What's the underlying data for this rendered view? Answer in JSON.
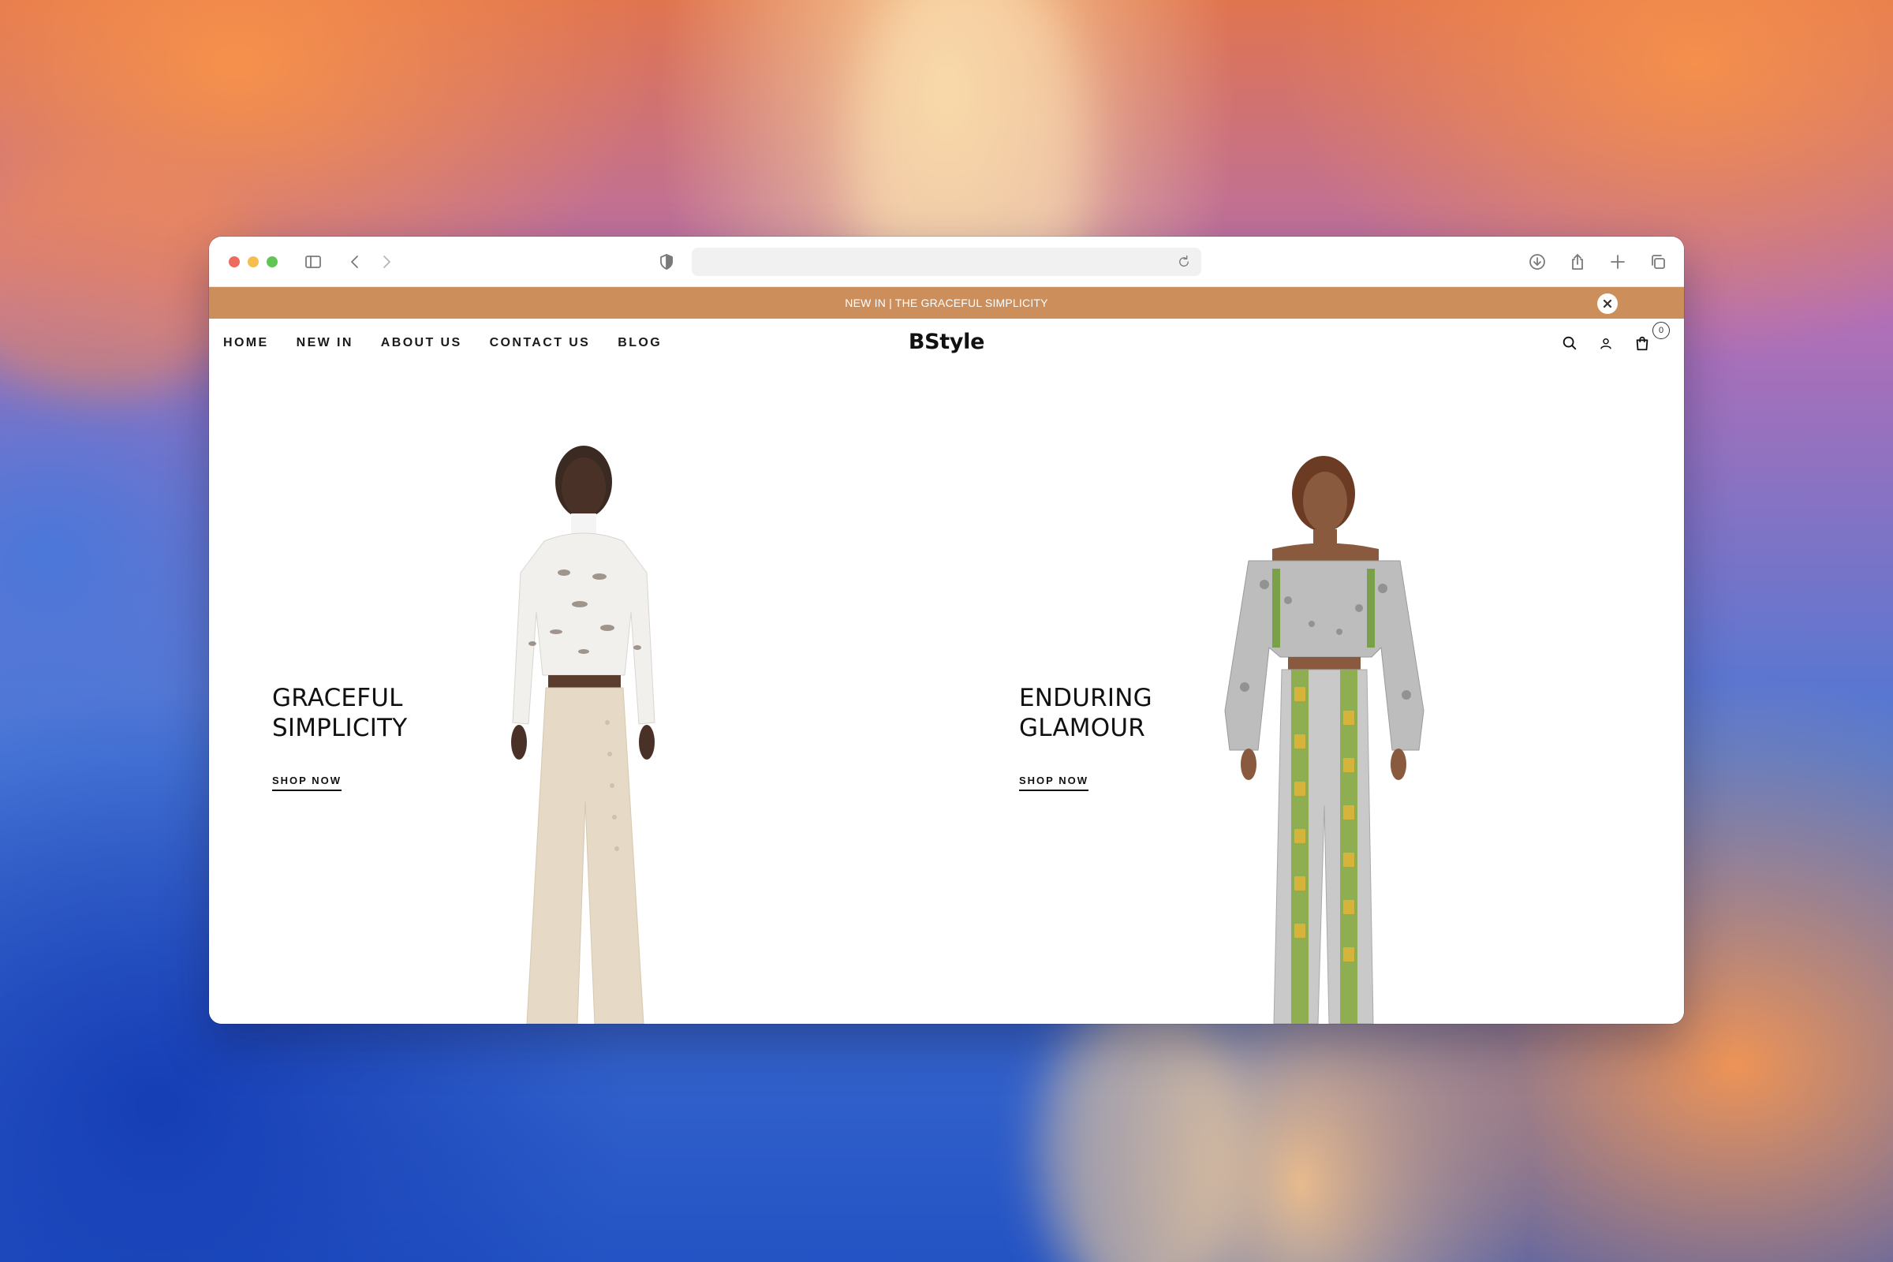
{
  "browser": {
    "url": ""
  },
  "announcement": {
    "text": "NEW IN | THE GRACEFUL SIMPLICITY"
  },
  "nav": {
    "links": [
      "HOME",
      "NEW IN",
      "ABOUT US",
      "CONTACT US",
      "BLOG"
    ],
    "logo": "BStyle",
    "cart_count": "0"
  },
  "hero": {
    "left": {
      "title": "GRACEFUL SIMPLICITY",
      "cta": "SHOP NOW"
    },
    "right": {
      "title": "ENDURING GLAMOUR",
      "cta": "SHOP NOW"
    }
  },
  "colors": {
    "announcement_bg": "#cc8f5c",
    "text": "#111111",
    "background": "#ffffff"
  },
  "icons": [
    "sidebar-toggle-icon",
    "back-icon",
    "forward-icon",
    "shield-icon",
    "reload-icon",
    "download-icon",
    "share-icon",
    "new-tab-icon",
    "tabs-overview-icon",
    "close-icon",
    "search-icon",
    "account-icon",
    "cart-icon"
  ]
}
